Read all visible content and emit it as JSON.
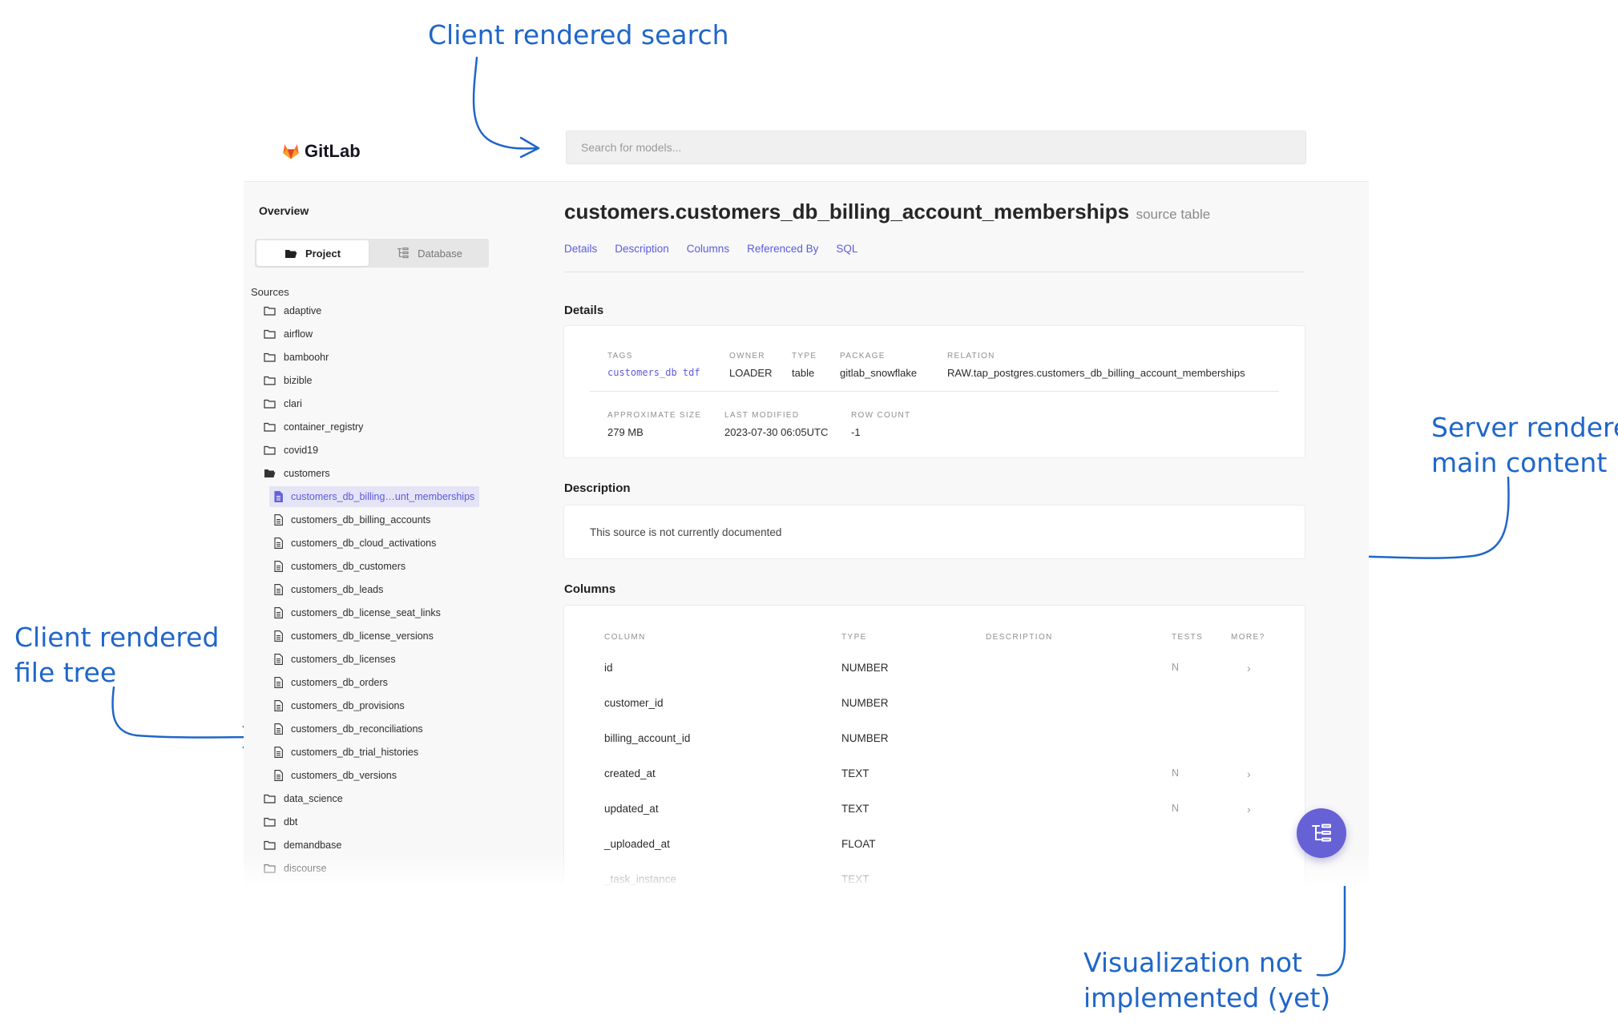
{
  "annotations": {
    "search": "Client rendered search",
    "main_line1": "Server rendered",
    "main_line2": "main content",
    "tree_line1": "Client rendered",
    "tree_line2": "file tree",
    "viz_line1": "Visualization not",
    "viz_line2": "implemented (yet)"
  },
  "header": {
    "logo_text": "GitLab",
    "search_placeholder": "Search for models..."
  },
  "sidebar": {
    "overview": "Overview",
    "toggle_project": "Project",
    "toggle_database": "Database",
    "sources_label": "Sources",
    "folders_before": [
      "adaptive",
      "airflow",
      "bamboohr",
      "bizible",
      "clari",
      "container_registry",
      "covid19"
    ],
    "open_folder": "customers",
    "files": [
      "customers_db_billing…unt_memberships",
      "customers_db_billing_accounts",
      "customers_db_cloud_activations",
      "customers_db_customers",
      "customers_db_leads",
      "customers_db_license_seat_links",
      "customers_db_license_versions",
      "customers_db_licenses",
      "customers_db_orders",
      "customers_db_provisions",
      "customers_db_reconciliations",
      "customers_db_trial_histories",
      "customers_db_versions"
    ],
    "folders_after": [
      "data_science",
      "dbt",
      "demandbase",
      "discourse"
    ]
  },
  "main": {
    "title": "customers.customers_db_billing_account_memberships",
    "title_suffix": "source table",
    "tabs": [
      "Details",
      "Description",
      "Columns",
      "Referenced By",
      "SQL"
    ],
    "details_heading": "Details",
    "details": {
      "tags_label": "Tags",
      "tags_value": "customers_db tdf",
      "owner_label": "Owner",
      "owner_value": "LOADER",
      "type_label": "Type",
      "type_value": "table",
      "package_label": "Package",
      "package_value": "gitlab_snowflake",
      "relation_label": "Relation",
      "relation_value": "RAW.tap_postgres.customers_db_billing_account_memberships",
      "size_label": "Approximate Size",
      "size_value": "279 MB",
      "modified_label": "Last Modified",
      "modified_value": "2023-07-30 06:05UTC",
      "rowcount_label": "Row Count",
      "rowcount_value": "-1"
    },
    "description_heading": "Description",
    "description_text": "This source is not currently documented",
    "columns_heading": "Columns",
    "columns_table": {
      "headers": [
        "Column",
        "Type",
        "Description",
        "Tests",
        "More?"
      ],
      "rows": [
        {
          "name": "id",
          "type": "NUMBER",
          "tests": "N",
          "more": "›"
        },
        {
          "name": "customer_id",
          "type": "NUMBER",
          "tests": "",
          "more": ""
        },
        {
          "name": "billing_account_id",
          "type": "NUMBER",
          "tests": "",
          "more": ""
        },
        {
          "name": "created_at",
          "type": "TEXT",
          "tests": "N",
          "more": "›"
        },
        {
          "name": "updated_at",
          "type": "TEXT",
          "tests": "N",
          "more": "›"
        },
        {
          "name": "_uploaded_at",
          "type": "FLOAT",
          "tests": "",
          "more": ""
        },
        {
          "name": "_task_instance",
          "type": "TEXT",
          "tests": "",
          "more": ""
        }
      ]
    }
  },
  "colors": {
    "accent": "#5b5be0",
    "annotation": "#1f66c9",
    "fab": "#6761d6",
    "gitlab_orange": "#fc6d26"
  },
  "icons": {
    "logo": "gitlab-tanuki-icon",
    "folder": "folder-icon",
    "file": "file-icon",
    "fab": "tree-graph-icon"
  }
}
